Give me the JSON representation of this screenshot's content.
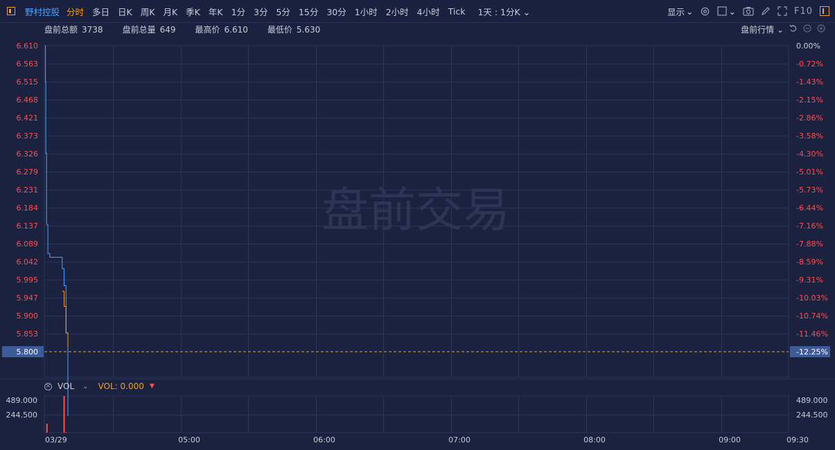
{
  "toolbar": {
    "stock_name": "野村控股",
    "tabs": [
      "分时",
      "多日",
      "日K",
      "周K",
      "月K",
      "季K",
      "年K",
      "1分",
      "3分",
      "5分",
      "15分",
      "30分",
      "1小时",
      "2小时",
      "4小时",
      "Tick"
    ],
    "active_tab": "分时",
    "interval_dropdown": "1天 : 1分K",
    "display_label": "显示",
    "f10_label": "F10"
  },
  "info": {
    "total_amount_label": "盘前总额",
    "total_amount": "3738",
    "total_volume_label": "盘前总量",
    "total_volume": "649",
    "high_label": "最高价",
    "high": "6.610",
    "low_label": "最低价",
    "low": "5.630",
    "quote_dropdown": "盘前行情"
  },
  "watermark": "盘前交易",
  "volume_header": {
    "name": "VOL",
    "value_text": "VOL: 0.000"
  },
  "colors": {
    "background": "#1b2240",
    "grid": "#2a3458",
    "price_line": "#4aa3ff",
    "avg_line": "#f0a020",
    "down": "#ff4d4f",
    "accent": "#f0a020",
    "current_price_bg": "#3d5a99"
  },
  "chart_data": {
    "type": "line",
    "price_axis": {
      "ticks": [
        "6.610",
        "6.563",
        "6.515",
        "6.468",
        "6.421",
        "6.373",
        "6.326",
        "6.279",
        "6.231",
        "6.184",
        "6.137",
        "6.089",
        "6.042",
        "5.995",
        "5.947",
        "5.900",
        "5.853",
        "5.800"
      ],
      "ylim": [
        5.8,
        6.61
      ]
    },
    "percent_axis": {
      "ticks": [
        "0.00%",
        "-0.72%",
        "-1.43%",
        "-2.15%",
        "-2.86%",
        "-3.58%",
        "-4.30%",
        "-5.01%",
        "-5.73%",
        "-6.44%",
        "-7.16%",
        "-7.88%",
        "-8.59%",
        "-9.31%",
        "-10.03%",
        "-10.74%",
        "-11.46%",
        "-12.25%"
      ]
    },
    "current_price": "5.800",
    "current_percent": "-12.25%",
    "x_ticks": [
      "03/29",
      "05:00",
      "06:00",
      "07:00",
      "08:00",
      "09:00",
      "09:30"
    ],
    "price_series": {
      "name": "price",
      "x": [
        0,
        0.2,
        0.4,
        0.8,
        1.5,
        2.5,
        5,
        8,
        9,
        10,
        11,
        12
      ],
      "y": [
        6.61,
        6.515,
        6.326,
        6.137,
        6.06,
        6.05,
        6.05,
        6.05,
        6.02,
        5.975,
        5.85,
        5.63
      ]
    },
    "avg_series": {
      "name": "avg",
      "x": [
        9,
        10,
        11,
        12
      ],
      "y": [
        5.96,
        5.92,
        5.85,
        5.81
      ]
    },
    "volume": {
      "ticks": [
        "489.000",
        "244.500"
      ],
      "ylim": [
        0,
        489
      ],
      "bars": [
        {
          "x": 1,
          "value": 120
        },
        {
          "x": 10,
          "value": 489
        },
        {
          "x": 11,
          "value": 8
        }
      ]
    }
  }
}
